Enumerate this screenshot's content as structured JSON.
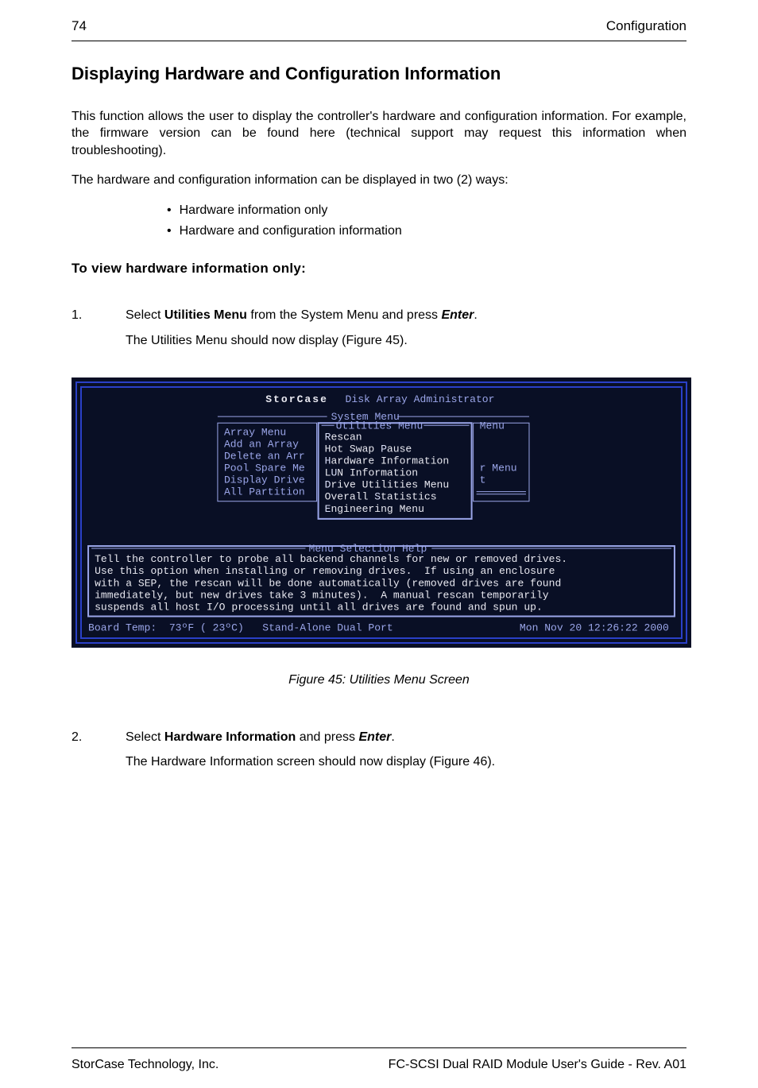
{
  "header": {
    "pageNumber": "74",
    "section": "Configuration"
  },
  "title": "Displaying Hardware and Configuration Information",
  "para1": "This function allows the user to display the controller's hardware and configuration information.  For example, the firmware version can be found here (technical support may request this information when troubleshooting).",
  "para2": "The hardware and configuration information can be displayed in two (2) ways:",
  "bullets": [
    "Hardware information only",
    "Hardware and configuration information"
  ],
  "subhead": "To view hardware information only:",
  "step1": {
    "num": "1.",
    "text_pre": "Select ",
    "bold1": "Utilities Menu",
    "text_mid": " from the System Menu and press ",
    "boldit": "Enter",
    "text_post": ".",
    "line2": "The Utilities Menu should now display (Figure 45)."
  },
  "console": {
    "title_pre": "StorCase",
    "title_post": " Disk Array Administrator",
    "sys_label": "System Menu",
    "util_label": "Utilities Menu",
    "menu_label": "Menu",
    "left_items": [
      "Array Menu",
      "Add an Array",
      "Delete an Arr",
      "Pool Spare Me",
      "Display Drive",
      "All Partition"
    ],
    "util_items": [
      {
        "hl": "R",
        "rest": "escan"
      },
      {
        "hl": "",
        "rest": "Hot Swap ",
        "hl2": "P",
        "rest2": "ause"
      },
      {
        "hl": "H",
        "rest": "ardware Information"
      },
      {
        "hl": "",
        "rest": "L",
        "hl2": "U",
        "rest2": "N Information"
      },
      {
        "hl": "D",
        "rest": "rive Utilities Menu"
      },
      {
        "hl": "",
        "rest": "Overall ",
        "hl2": "S",
        "rest2": "tatistics"
      },
      {
        "hl": "E",
        "rest": "ngineering Menu"
      }
    ],
    "right_items": [
      "r Menu",
      "t"
    ],
    "help_label": "Menu Selection Help",
    "help_lines": [
      "Tell the controller to probe all backend channels for new or removed drives.",
      "Use this option when installing or removing drives.  If using an enclosure",
      "with a SEP, the rescan will be done automatically (removed drives are found",
      "immediately, but new drives take 3 minutes).  A manual rescan temporarily",
      "suspends all host I/O processing until all drives are found and spun up."
    ],
    "status_left": "Board Temp:  73ºF ( 23ºC)   Stand-Alone Dual Port",
    "status_right": "Mon Nov 20 12:26:22 2000"
  },
  "figure_caption": "Figure 45:  Utilities Menu Screen",
  "step2": {
    "num": "2.",
    "text_pre": "Select ",
    "bold1": "Hardware Information",
    "text_mid": " and press ",
    "boldit": "Enter",
    "text_post": ".",
    "line2": "The Hardware Information screen should now display (Figure 46)."
  },
  "footer": {
    "left": "StorCase Technology, Inc.",
    "right": "FC-SCSI Dual RAID Module User's Guide - Rev. A01"
  }
}
